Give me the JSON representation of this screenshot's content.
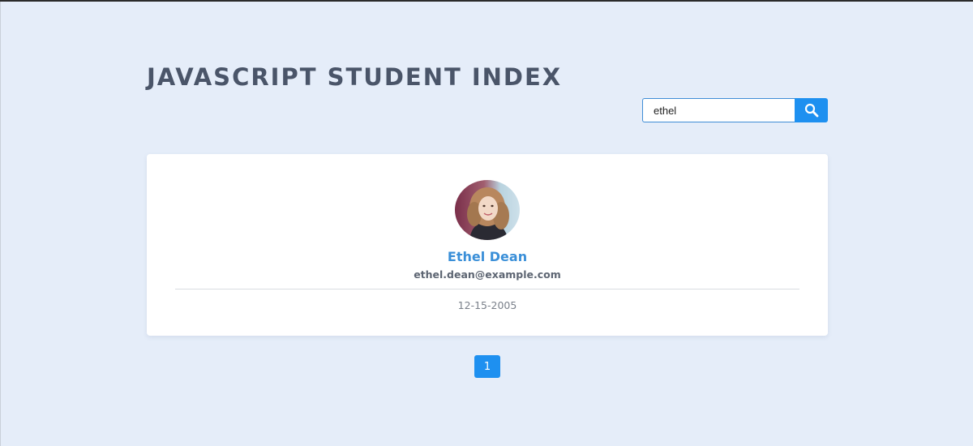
{
  "header": {
    "title": "JAVASCRIPT STUDENT INDEX"
  },
  "search": {
    "value": "ethel",
    "button_icon": "search-icon"
  },
  "students": [
    {
      "name": "Ethel Dean",
      "email": "ethel.dean@example.com",
      "joined": "12-15-2005",
      "avatar_icon": "student-photo"
    }
  ],
  "pagination": {
    "pages": [
      "1"
    ],
    "active": "1"
  },
  "colors": {
    "background": "#e5edf9",
    "accent": "#1e90f0",
    "name": "#3a8fd8",
    "title": "#4a5569"
  }
}
